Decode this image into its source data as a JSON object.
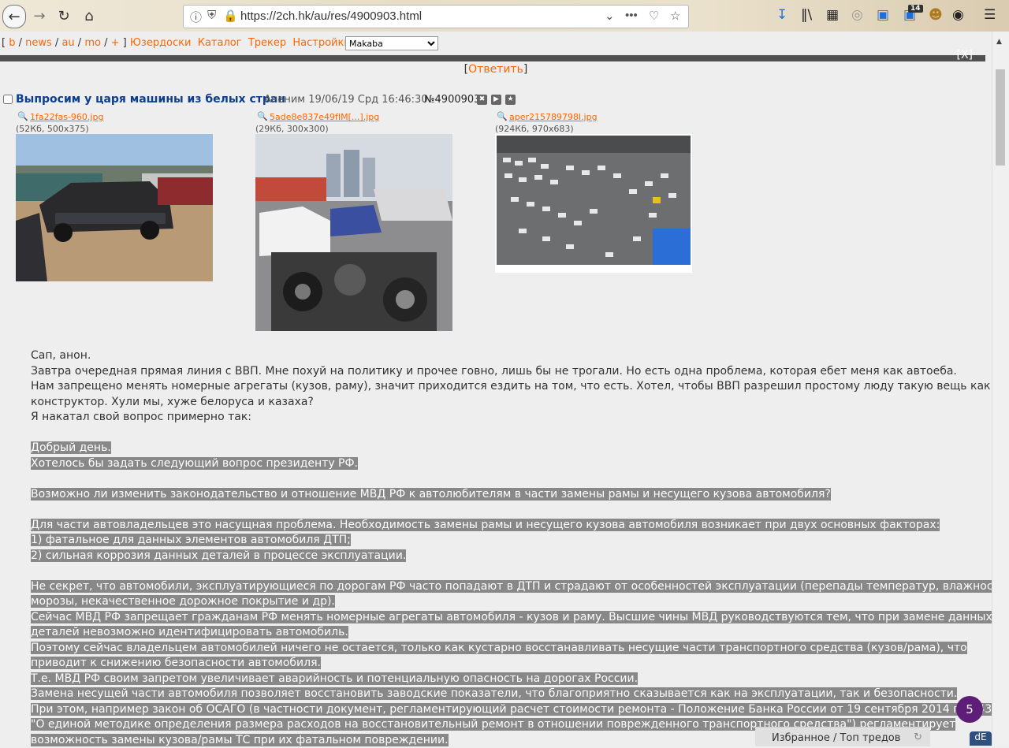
{
  "browser": {
    "url": "https://2ch.hk/au/res/4900903.html",
    "notification_count": "14"
  },
  "nav": {
    "open_bracket": "[",
    "boards": [
      "b",
      "news",
      "au",
      "mo",
      "+"
    ],
    "close_bracket": "]",
    "links": [
      "Юзердоски",
      "Каталог",
      "Трекер",
      "Настройки"
    ],
    "style_select": "Makaba"
  },
  "reply": {
    "open": "[",
    "label": "Ответить",
    "close": "]"
  },
  "post": {
    "title": "Выпросим у царя машины из белых стран",
    "meta": "Аноним 19/06/19 Срд 16:46:30",
    "number": "№4900903",
    "files": [
      {
        "name": "1fa22fas-960.jpg",
        "info": "(52Кб, 500x375)"
      },
      {
        "name": "5ade8e837e49fIM[...].jpg",
        "info": "(29Кб, 300x300)"
      },
      {
        "name": "aper215789798l.jpg",
        "info": "(924Кб, 970x683)"
      }
    ],
    "lines": [
      "Сап, анон.",
      "Завтра очередная прямая линия с ВВП. Мне похуй на политику и прочее говно, лишь бы не трогали. Но есть одна проблема, которая ебет меня как автоеба.",
      "Нам запрещено менять номерные агрегаты (кузов, раму), значит приходится ездить на том, что есть. Хотел, чтобы ВВП разрешил простому люду такую вещь как",
      "конструктор. Хули мы, хуже белоруса и казаха?",
      "Я накатал свой вопрос примерно так:"
    ],
    "spoiler_lines": [
      "Добрый день.",
      "Хотелось бы задать следующий вопрос президенту РФ.",
      "",
      "Возможно ли изменить законодательство и отношение МВД РФ к автолюбителям в части замены рамы и несущего кузова автомобиля?",
      "",
      "Для части автовладельцев это насущная проблема. Необходимость замены рамы и несущего кузова автомобиля возникает при двух основных факторах:",
      "1) фатальное для данных элементов автомобиля ДТП;",
      "2) сильная коррозия данных деталей в процессе эксплуатации.",
      "",
      "Не секрет, что автомобили, эксплуатирующиеся по дорогам РФ часто попадают в ДТП и страдают от особенностей эксплуатации (перепады температур, влажность,",
      "морозы, некачественное дорожное покрытие и др).",
      "Сейчас МВД РФ запрещает гражданам РФ менять номерные агрегаты автомобиля - кузов и раму. Высшие чины МВД руководствуются тем, что при замене данных",
      "деталей невозможно идентифицировать автомобиль.",
      "Поэтому сейчас владельцем автомобилей ничего не остается, только как кустарно восстанавливать несущие части транспортного средства (кузов/рама), что",
      "приводит к снижению безопасности автомобиля.",
      "Т.е. МВД РФ своим запретом увеличивает аварийность и потенциальную опасность на дорогах России.",
      "Замена несущей части автомобиля позволяет восстановить заводские показатели, что благоприятно сказывается как на эксплуатации, так и безопасности.",
      "При этом, например закон об ОСАГО (в частности документ, регламентирующий расчет стоимости ремонта - Положение Банка России от 19 сентября 2014 г. N 432-П",
      "\"О единой методике определения размера расходов на восстановительный ремонт в отношении поврежденного транспортного средства\") регламентирует",
      "возможность замены кузова/рамы ТС при их фатальном повреждении."
    ]
  },
  "footer": {
    "favorites": "Избранное / Топ тредов",
    "unread_count": "5",
    "addon_badge": "dE"
  }
}
